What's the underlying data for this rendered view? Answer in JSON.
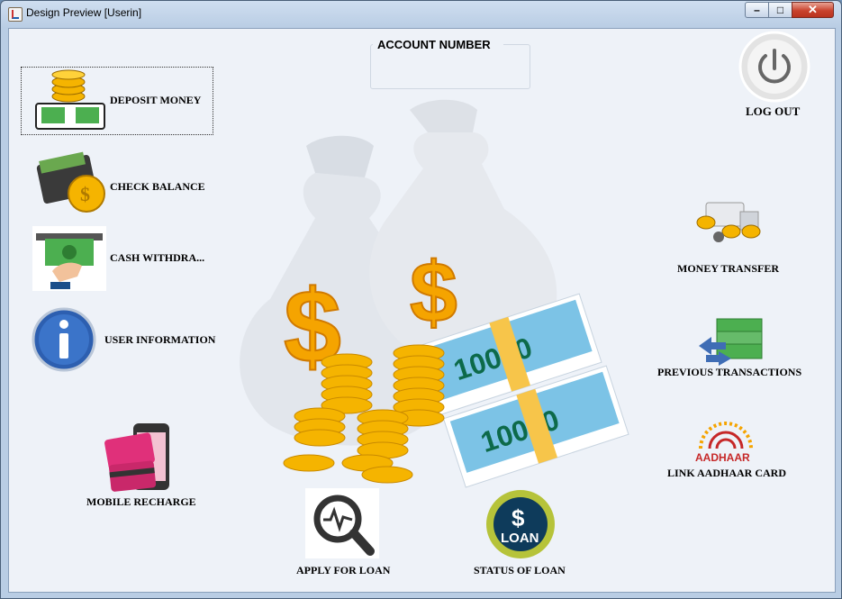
{
  "window": {
    "title": "Design Preview [Userin]",
    "minimize": "–",
    "maximize": "□",
    "close": "✕"
  },
  "account": {
    "label": "ACCOUNT NUMBER",
    "value": ""
  },
  "buttons": {
    "deposit": "DEPOSIT MONEY",
    "check_balance": "CHECK BALANCE",
    "cash_withdraw": "CASH WITHDRA...",
    "user_info": "USER INFORMATION",
    "mobile_recharge": "MOBILE RECHARGE",
    "apply_loan": "APPLY FOR LOAN",
    "status_loan": "STATUS OF LOAN",
    "logout": "LOG OUT",
    "money_transfer": "MONEY TRANSFER",
    "previous_transactions": "PREVIOUS TRANSACTIONS",
    "link_aadhaar": "LINK AADHAAR CARD"
  },
  "art": {
    "banknote_value_1": "10000",
    "banknote_value_2": "10000",
    "dollar": "$",
    "loan_badge_dollar": "$",
    "loan_badge_text": "LOAN",
    "aadhaar_text": "AADHAAR"
  },
  "colors": {
    "gold": "#f5a400",
    "note_green": "#3aa84b",
    "close_red": "#c9432e",
    "loan_navy": "#0e3b5b"
  }
}
